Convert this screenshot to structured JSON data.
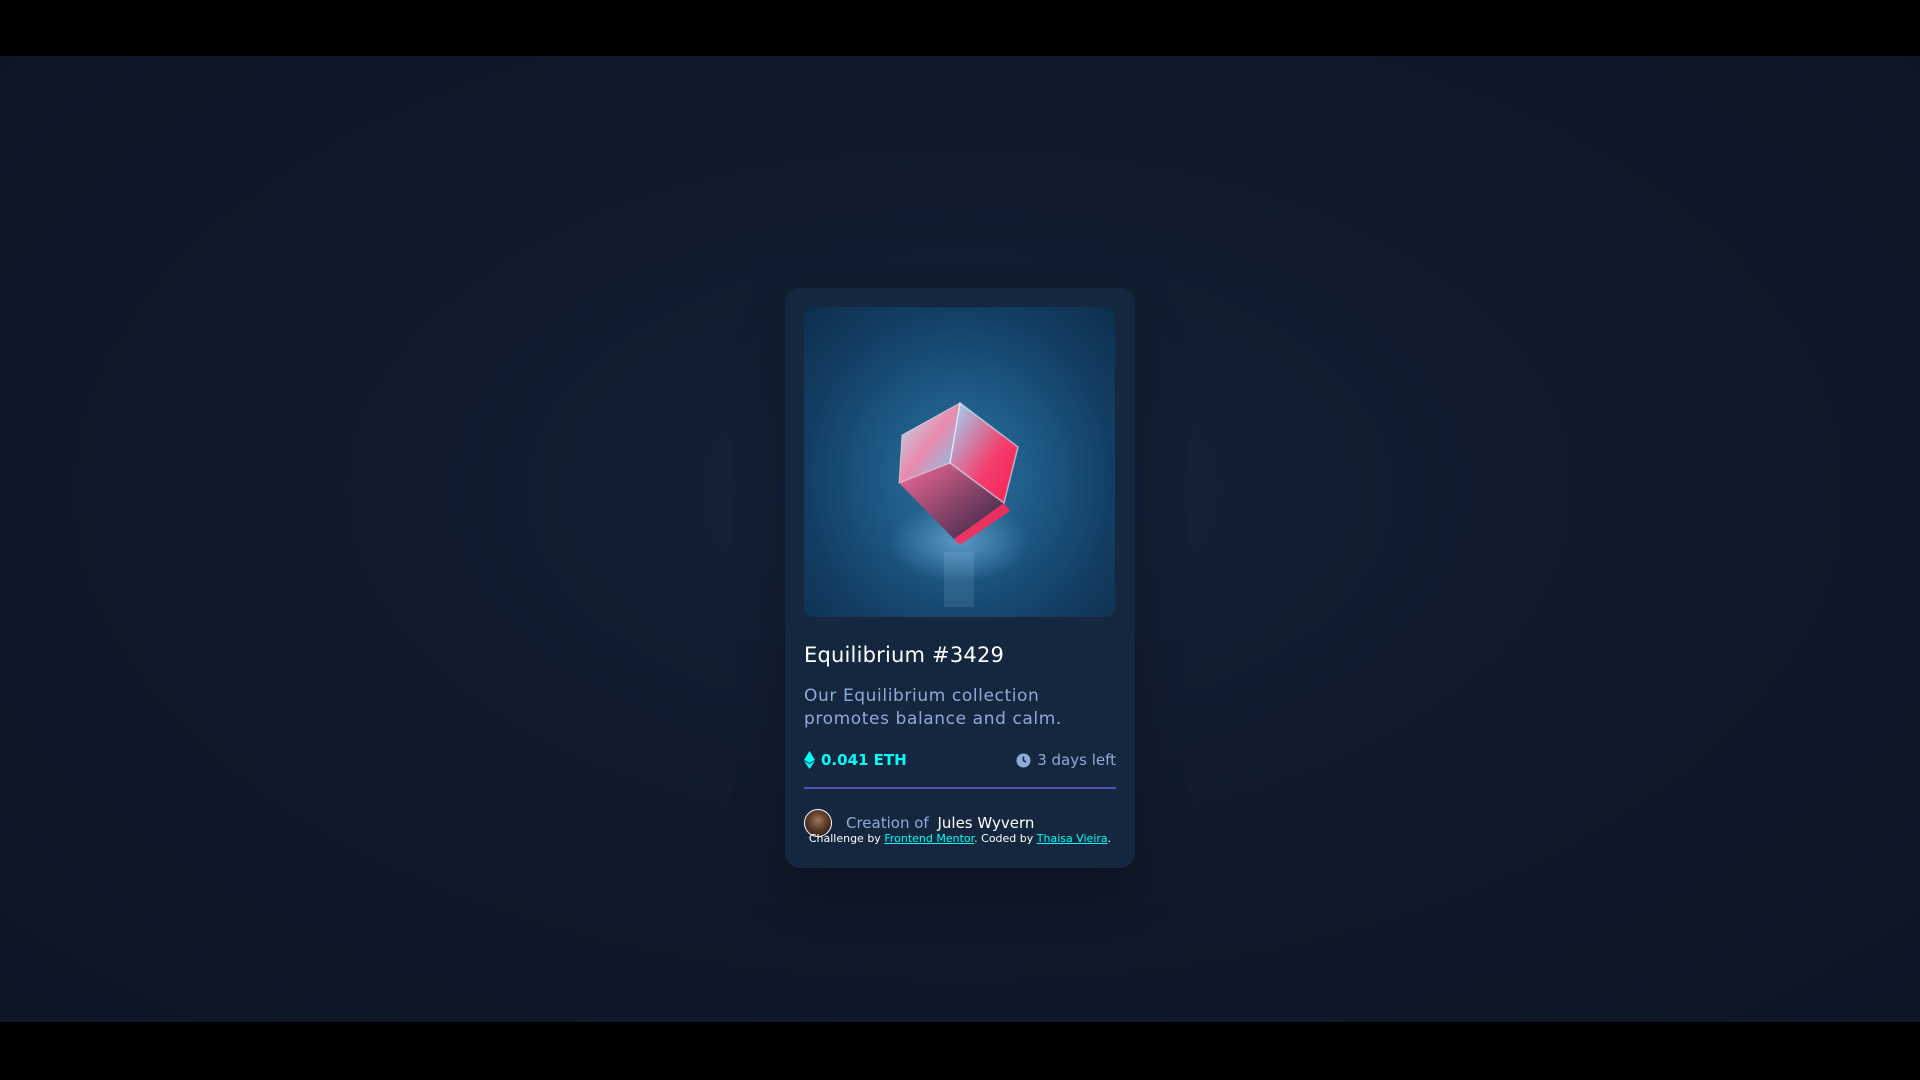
{
  "card": {
    "title": "Equilibrium #3429",
    "description": "Our Equilibrium collection promotes balance and calm.",
    "price": "0.041 ETH",
    "time_left": "3 days left",
    "creator_prefix": "Creation of",
    "creator_name": "Jules Wyvern",
    "image_alt": "Equilibrium #3429 cube",
    "icons": {
      "price": "ethereum-icon",
      "time": "clock-icon"
    }
  },
  "attribution": {
    "prefix": "Challenge by",
    "link1": "Frontend Mentor",
    "middle": ". Coded by",
    "link2": "Thaisa Vieira",
    "suffix": "."
  },
  "colors": {
    "accent": "#00fff8",
    "muted_text": "#8bacd9",
    "card_bg": "#15263f",
    "page_bg": "#0f1a2c"
  }
}
